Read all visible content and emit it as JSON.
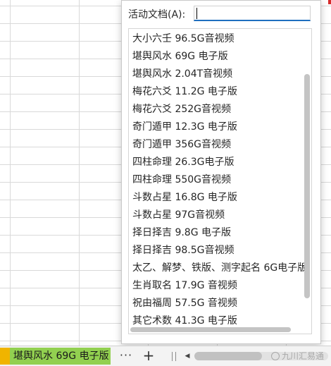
{
  "dialog": {
    "label": "活动文档(A):",
    "search_value": "",
    "items": [
      {
        "label": "大小六壬 96.5G音视频"
      },
      {
        "label": "堪舆风水 69G 电子版"
      },
      {
        "label": "堪舆风水 2.04T音视频"
      },
      {
        "label": "梅花六爻 11.2G 电子版"
      },
      {
        "label": "梅花六爻 252G音视频"
      },
      {
        "label": "奇门遁甲 12.3G 电子版"
      },
      {
        "label": "奇门遁甲 356G音视频"
      },
      {
        "label": "四柱命理 26.3G电子版"
      },
      {
        "label": "四柱命理 550G音视频"
      },
      {
        "label": "斗数占星 16.8G 电子版"
      },
      {
        "label": "斗数占星 97G音视频"
      },
      {
        "label": "择日择吉 9.8G 电子版"
      },
      {
        "label": "择日择吉 98.5G音视频"
      },
      {
        "label": "太乙、解梦、铁版、测字起名 6G电子版"
      },
      {
        "label": "生肖取名 17.9G 音视频"
      },
      {
        "label": "祝由福周 57.5G 音视频"
      },
      {
        "label": "其它术数 41.3G 电子版"
      }
    ]
  },
  "tabbar": {
    "active_sheet": "堪舆风水 69G 电子版",
    "more_label": "···",
    "add_label": "+",
    "scroll_left_label": "◀",
    "watermark": "九川汇易通"
  },
  "colors": {
    "sheet_tab": "#92d050",
    "accent_strip": "#f0b400",
    "input_focus": "#1f6fbf"
  }
}
